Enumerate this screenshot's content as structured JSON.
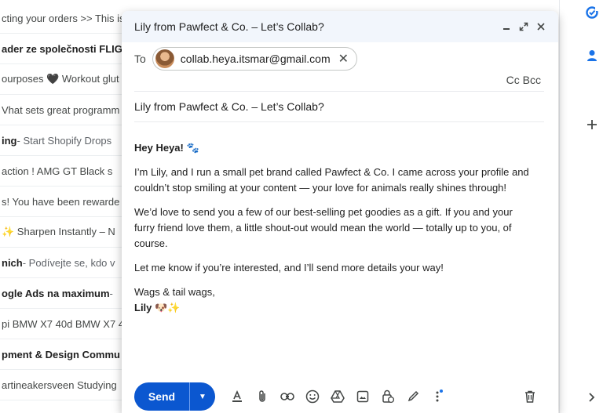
{
  "inbox": {
    "rows": [
      {
        "bold": "",
        "text": "cting your orders >> This is"
      },
      {
        "bold": "ader ze společnosti FLIG",
        "text": ""
      },
      {
        "bold": "",
        "text": "ourposes 🖤 Workout glut"
      },
      {
        "bold": "",
        "text": "Vhat sets great programm"
      },
      {
        "bold": "ing",
        "text": " - Start Shopify Drops"
      },
      {
        "bold": "",
        "text": " action ! AMG GT Black s"
      },
      {
        "bold": "",
        "text": "s! You have been rewarde"
      },
      {
        "bold": "",
        "text": "✨ Sharpen Instantly – N"
      },
      {
        "bold": "nich",
        "text": " - Podívejte se, kdo v"
      },
      {
        "bold": "ogle Ads na maximum",
        "text": " -"
      },
      {
        "bold": "",
        "text": "pi BMW X7 40d BMW X7 4"
      },
      {
        "bold": "pment & Design Commu",
        "text": ""
      },
      {
        "bold": "",
        "text": "artineakersveen Studying"
      }
    ]
  },
  "compose": {
    "title": "Lily from Pawfect & Co. – Let’s Collab?",
    "to_label": "To",
    "recipient_email": "collab.heya.itsmar@gmail.com",
    "cc_bcc": "Cc Bcc",
    "subject": "Lily from Pawfect & Co. – Let’s Collab?",
    "body": {
      "greeting": "Hey Heya! 🐾",
      "p1": "I’m Lily, and I run a small pet brand called Pawfect & Co. I came across your profile and couldn’t stop smiling at your content — your love for animals really shines through!",
      "p2": "We’d love to send you a few of our best-selling pet goodies as a gift. If you and your furry friend love them, a little shout-out would mean the world — totally up to you, of course.",
      "p3": "Let me know if you’re interested, and I’ll send more details your way!",
      "signoff": "Wags & tail wags,",
      "signature": "Lily 🐶✨"
    },
    "send_label": "Send"
  },
  "colors": {
    "accent": "#0b57d0",
    "header_bg": "#f2f6fc"
  },
  "icons": {
    "header": [
      "minimize-icon",
      "expand-icon",
      "close-icon"
    ],
    "toolbar": [
      "format-text-icon",
      "attach-icon",
      "link-icon",
      "emoji-icon",
      "drive-icon",
      "photo-icon",
      "lock-clock-icon",
      "signature-pen-icon",
      "more-options-icon",
      "trash-icon"
    ],
    "rail": [
      "tasks-icon",
      "contacts-icon",
      "add-icon",
      "expand-panel-icon"
    ]
  }
}
